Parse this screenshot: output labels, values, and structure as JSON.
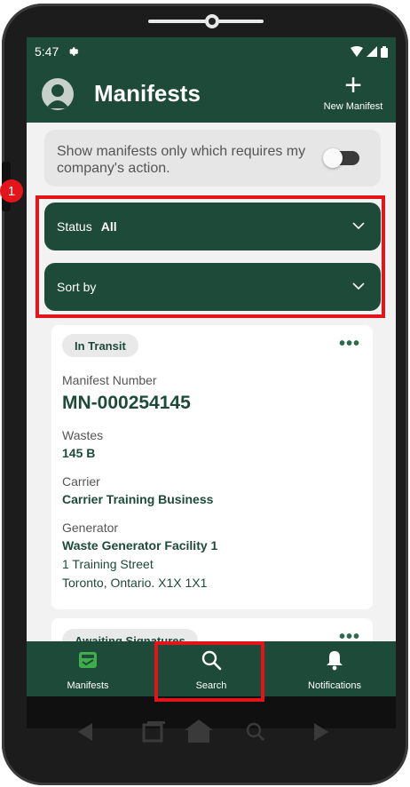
{
  "status_bar": {
    "time": "5:47"
  },
  "header": {
    "title": "Manifests",
    "new_manifest_label": "New Manifest"
  },
  "filter": {
    "toggle_text": "Show manifests only which requires my company's action.",
    "toggle_on": false
  },
  "dropdowns": {
    "status": {
      "label": "Status",
      "value": "All"
    },
    "sort": {
      "label": "Sort by"
    }
  },
  "annotation": {
    "number": "1"
  },
  "manifest_card": {
    "status": "In Transit",
    "manifest_number_label": "Manifest Number",
    "manifest_number": "MN-000254145",
    "wastes_label": "Wastes",
    "wastes_value": "145 B",
    "carrier_label": "Carrier",
    "carrier_value": "Carrier Training Business",
    "generator_label": "Generator",
    "generator_name": "Waste Generator Facility 1",
    "generator_street": "1 Training Street",
    "generator_city": "Toronto, Ontario. X1X 1X1",
    "more_glyph": "•••"
  },
  "manifest_card_2": {
    "status": "Awaiting Signatures",
    "more_glyph": "•••"
  },
  "bottom_nav": [
    {
      "label": "Manifests",
      "icon": "manifests-icon"
    },
    {
      "label": "Search",
      "icon": "search-icon"
    },
    {
      "label": "Notifications",
      "icon": "bell-icon"
    }
  ],
  "colors": {
    "primary": "#1e4a3a",
    "accent_green": "#3fae4a",
    "highlight": "#e3151a",
    "background": "#f2f2f2"
  }
}
